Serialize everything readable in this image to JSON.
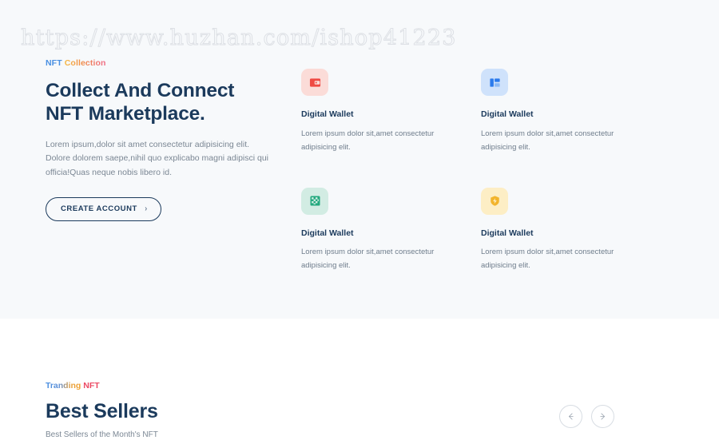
{
  "watermark": "https://www.huzhan.com/ishop41223",
  "hero": {
    "eyebrow_part1": "NFT",
    "eyebrow_part2": "Collection",
    "title": "Collect And Connect NFT Marketplace.",
    "description": "Lorem ipsum,dolor sit amet consectetur adipisicing elit. Dolore dolorem saepe,nihil quo explicabo magni adipisci qui officia!Quas neque nobis libero id.",
    "cta_label": "CREATE ACCOUNT",
    "cta_chevron": "›"
  },
  "features": [
    {
      "icon_name": "wallet-card-icon",
      "icon_bg": "#fbdcd8",
      "icon_color": "#ef4a43",
      "title": "Digital Wallet",
      "description": "Lorem ipsum dolor sit,amet consectetur adipisicing elit."
    },
    {
      "icon_name": "layout-columns-icon",
      "icon_bg": "#cfe2fb",
      "icon_color": "#2b7bec",
      "title": "Digital Wallet",
      "description": "Lorem ipsum dolor sit,amet consectetur adipisicing elit."
    },
    {
      "icon_name": "checkerboard-grid-icon",
      "icon_bg": "#d2ece3",
      "icon_color": "#23a97e",
      "title": "Digital Wallet",
      "description": "Lorem ipsum dolor sit,amet consectetur adipisicing elit."
    },
    {
      "icon_name": "shield-lightning-icon",
      "icon_bg": "#fdeec5",
      "icon_color": "#f2b42c",
      "title": "Digital Wallet",
      "description": "Lorem ipsum dolor sit,amet consectetur adipisicing elit."
    }
  ],
  "sellers": {
    "eyebrow_part1": "Tranding",
    "eyebrow_part2": "NFT",
    "title": "Best Sellers",
    "subtitle": "Best Sellers of the Month's NFT",
    "prev_label": "←",
    "next_label": "→"
  },
  "colors": {
    "page_bg": "#f7f9fb",
    "section_bg": "#ffffff",
    "heading": "#1b3a5c",
    "body_text": "#7b8794",
    "accent_blue": "#4a90e2",
    "accent_pink": "#ec4a63"
  }
}
